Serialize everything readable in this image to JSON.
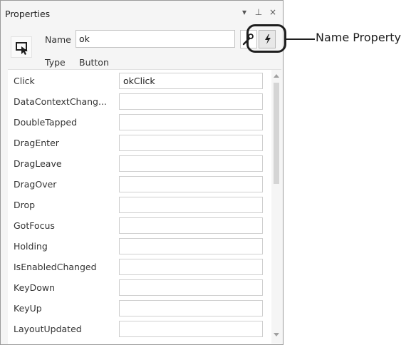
{
  "panel": {
    "title": "Properties",
    "controls": {
      "dropdown": "▾",
      "pin": "⊥",
      "close": "×"
    }
  },
  "element": {
    "name_label": "Name",
    "name_value": "ok",
    "type_label": "Type",
    "type_value": "Button"
  },
  "events": [
    {
      "label": "Click",
      "value": "okClick"
    },
    {
      "label": "DataContextChang...",
      "value": ""
    },
    {
      "label": "DoubleTapped",
      "value": ""
    },
    {
      "label": "DragEnter",
      "value": ""
    },
    {
      "label": "DragLeave",
      "value": ""
    },
    {
      "label": "DragOver",
      "value": ""
    },
    {
      "label": "Drop",
      "value": ""
    },
    {
      "label": "GotFocus",
      "value": ""
    },
    {
      "label": "Holding",
      "value": ""
    },
    {
      "label": "IsEnabledChanged",
      "value": ""
    },
    {
      "label": "KeyDown",
      "value": ""
    },
    {
      "label": "KeyUp",
      "value": ""
    },
    {
      "label": "LayoutUpdated",
      "value": ""
    }
  ],
  "callout": {
    "label": "Name Property"
  },
  "icons": {
    "element": "pointer-element-icon",
    "properties": "wrench-icon",
    "events": "lightning-icon",
    "scroll_up": "triangle-up-icon",
    "scroll_down": "triangle-down-icon"
  },
  "colors": {
    "panel_bg": "#f5f5f5",
    "text": "#1e1e1e",
    "border": "#c4c4c4",
    "scroll_thumb": "#d5d5d5"
  }
}
